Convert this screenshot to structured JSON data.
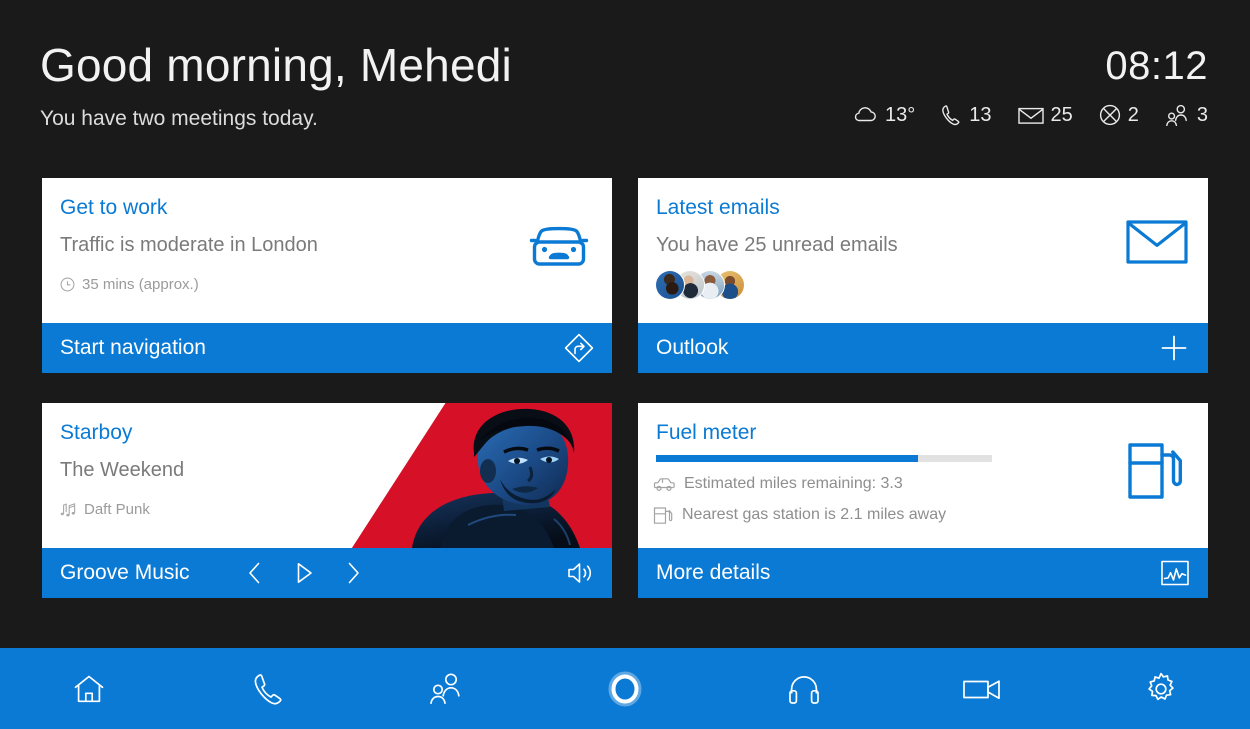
{
  "header": {
    "greeting": "Good morning, Mehedi",
    "subgreeting": "You have two meetings today.",
    "clock": "08:12",
    "status": [
      {
        "icon": "cloud-icon",
        "value": "13°"
      },
      {
        "icon": "phone-icon",
        "value": "13"
      },
      {
        "icon": "mail-icon",
        "value": "25"
      },
      {
        "icon": "xbox-icon",
        "value": "2"
      },
      {
        "icon": "people-icon",
        "value": "3"
      }
    ]
  },
  "cards": {
    "commute": {
      "title": "Get to work",
      "subtitle": "Traffic is moderate in London",
      "meta": "35 mins (approx.)",
      "meta_icon": "clock-icon",
      "big_icon": "car-front-icon",
      "action_label": "Start navigation",
      "action_icon": "navigation-diamond-icon"
    },
    "emails": {
      "title": "Latest emails",
      "subtitle": "You have 25 unread emails",
      "big_icon": "envelope-icon",
      "action_label": "Outlook",
      "action_icon": "plus-icon",
      "avatars": [
        "avatar-1",
        "avatar-2",
        "avatar-3",
        "avatar-4"
      ]
    },
    "music": {
      "title": "Starboy",
      "subtitle": "The Weekend",
      "meta": "Daft Punk",
      "meta_icon": "music-notes-icon",
      "album_art": "starboy-album-art",
      "action_label": "Groove Music",
      "controls": [
        "previous-icon",
        "play-icon",
        "next-icon"
      ],
      "volume_icon": "volume-icon"
    },
    "fuel": {
      "title": "Fuel meter",
      "progress_percent": 78,
      "progress_fill_color": "#0a7ad4",
      "progress_track_color": "#e2e2e2",
      "rows": [
        {
          "icon": "car-side-icon",
          "text": "Estimated miles remaining: 3.3"
        },
        {
          "icon": "gas-pump-icon",
          "text": "Nearest gas station is 2.1 miles away"
        }
      ],
      "big_icon": "gas-pump-icon",
      "action_label": "More details",
      "action_icon": "chart-icon"
    }
  },
  "navbar": {
    "items": [
      {
        "icon": "home-icon",
        "name": "nav-home"
      },
      {
        "icon": "phone-icon",
        "name": "nav-phone"
      },
      {
        "icon": "people-icon",
        "name": "nav-contacts"
      },
      {
        "icon": "cortana-icon",
        "name": "nav-cortana"
      },
      {
        "icon": "headphones-icon",
        "name": "nav-music"
      },
      {
        "icon": "video-icon",
        "name": "nav-video"
      },
      {
        "icon": "gear-icon",
        "name": "nav-settings"
      }
    ]
  },
  "colors": {
    "accent": "#0a7ad4",
    "background": "#1a1a1a",
    "card": "#ffffff",
    "album_red": "#d51027"
  }
}
